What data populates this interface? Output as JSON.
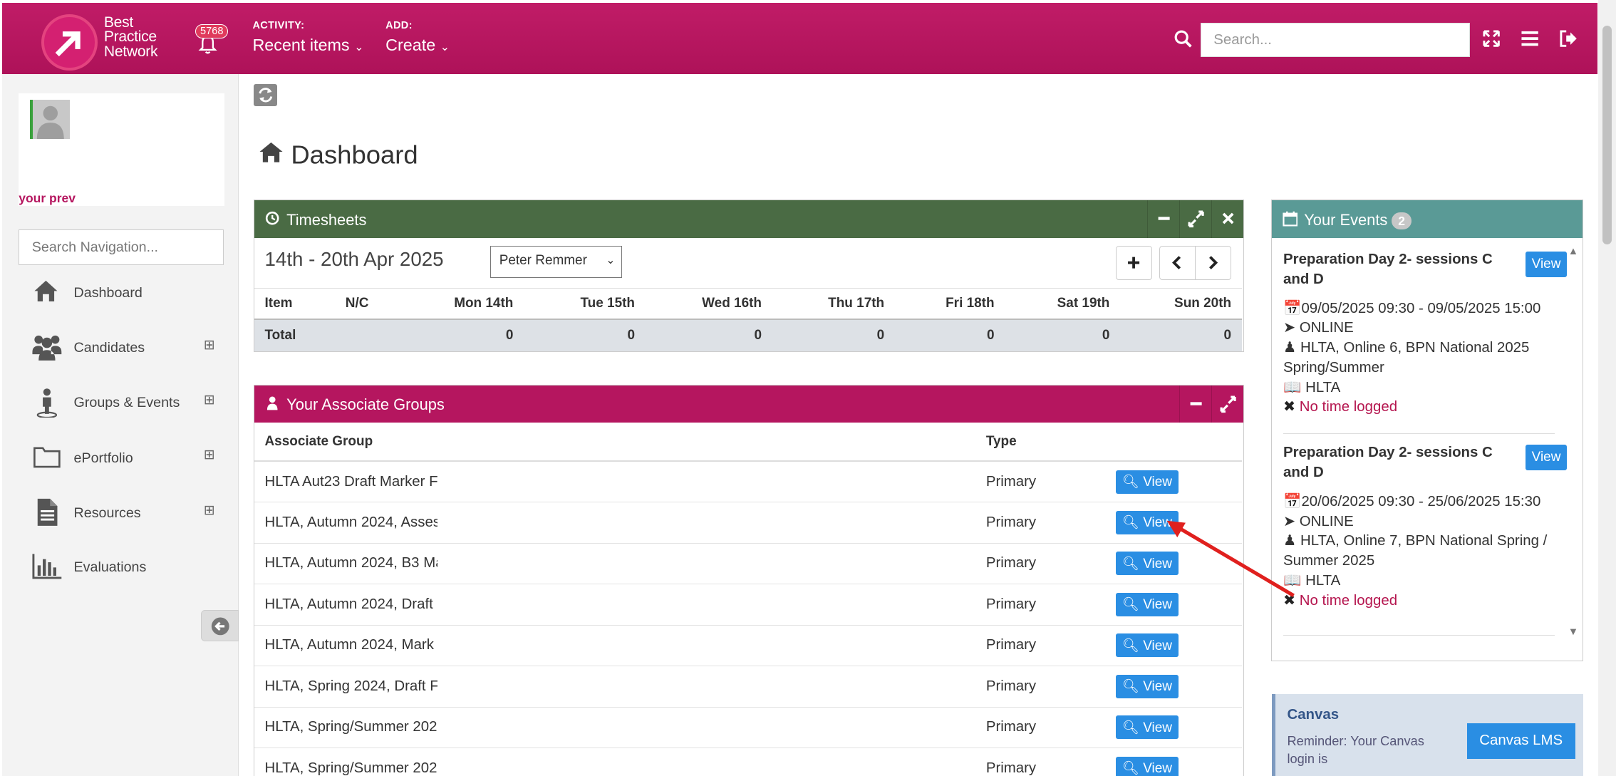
{
  "header": {
    "logo_line1": "Best",
    "logo_line2": "Practice",
    "logo_line3": "Network",
    "notifications_count": "5768",
    "activity_caption": "ACTIVITY:",
    "activity_value": "Recent items",
    "add_caption": "ADD:",
    "add_value": "Create",
    "search_placeholder": "Search..."
  },
  "sidebar": {
    "profile_note": "your prev",
    "search_placeholder": "Search Navigation...",
    "items": [
      {
        "label": "Dashboard",
        "icon": "home-icon",
        "expandable": false
      },
      {
        "label": "Candidates",
        "icon": "users-icon",
        "expandable": true
      },
      {
        "label": "Groups & Events",
        "icon": "person-pin-icon",
        "expandable": true
      },
      {
        "label": "ePortfolio",
        "icon": "folder-icon",
        "expandable": true
      },
      {
        "label": "Resources",
        "icon": "document-icon",
        "expandable": true
      },
      {
        "label": "Evaluations",
        "icon": "bar-chart-icon",
        "expandable": false
      }
    ]
  },
  "page": {
    "title": "Dashboard"
  },
  "timesheets": {
    "title": "Timesheets",
    "week": "14th - 20th Apr 2025",
    "selected_person": "Peter Remmer",
    "columns": [
      "Item",
      "N/C",
      "Mon 14th",
      "Tue 15th",
      "Wed 16th",
      "Thu 17th",
      "Fri 18th",
      "Sat 19th",
      "Sun 20th"
    ],
    "total_label": "Total",
    "totals": [
      "0",
      "0",
      "0",
      "0",
      "0",
      "0",
      "0"
    ],
    "header_color": "#4a6b44"
  },
  "associate_groups": {
    "title": "Your Associate Groups",
    "col_group": "Associate Group",
    "col_type": "Type",
    "view_label": "View",
    "rows": [
      {
        "name": "HLTA Aut23 Draft Marker F",
        "type": "Primary"
      },
      {
        "name": "HLTA, Autumn 2024, Asses",
        "type": "Primary"
      },
      {
        "name": "HLTA, Autumn 2024, B3 Ma",
        "type": "Primary"
      },
      {
        "name": "HLTA, Autumn 2024, Draft",
        "type": "Primary"
      },
      {
        "name": "HLTA, Autumn 2024, Mark",
        "type": "Primary"
      },
      {
        "name": "HLTA, Spring 2024, Draft F",
        "type": "Primary"
      },
      {
        "name": "HLTA, Spring/Summer 202",
        "type": "Primary"
      },
      {
        "name": "HLTA, Spring/Summer 202",
        "type": "Primary"
      }
    ],
    "header_color": "#b5165f"
  },
  "events": {
    "title": "Your Events",
    "count": "2",
    "view_label": "View",
    "items": [
      {
        "title": "Preparation Day 2- sessions C and D",
        "dates": "09/05/2025 09:30 - 09/05/2025 15:00",
        "location": "ONLINE",
        "group": "HLTA, Online 6, BPN National 2025 Spring/Summer",
        "course": "HLTA",
        "time_status": "No time logged"
      },
      {
        "title": "Preparation Day 2- sessions C and D",
        "dates": "20/06/2025 09:30 - 25/06/2025 15:30",
        "location": "ONLINE",
        "group": "HLTA, Online 7, BPN National Spring / Summer 2025",
        "course": "HLTA",
        "time_status": "No time logged"
      }
    ],
    "header_color": "#5a9a96"
  },
  "canvas": {
    "title": "Canvas",
    "text": "Reminder: Your Canvas login is",
    "button": "Canvas LMS"
  },
  "colors": {
    "brand": "#b5165f",
    "button_blue": "#2a8ee3",
    "annotation_arrow": "#e0201e"
  }
}
